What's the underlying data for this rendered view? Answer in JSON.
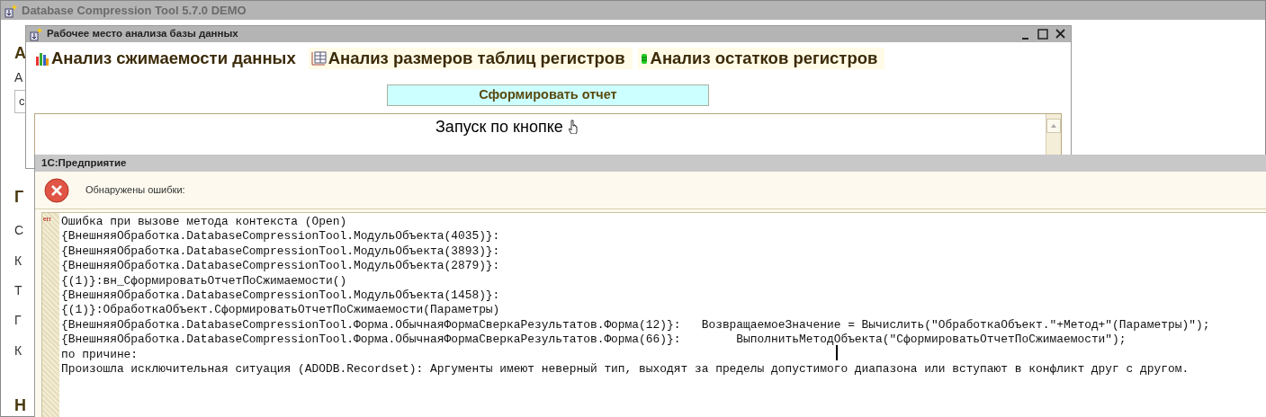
{
  "main_window": {
    "title": "Database Compression Tool 5.7.0 DEMO",
    "background_fragments": [
      {
        "text": "А",
        "kind": "heading"
      },
      {
        "text": "А",
        "kind": "label"
      },
      {
        "text": "с",
        "kind": "field"
      },
      {
        "text": "Г",
        "kind": "heading"
      },
      {
        "text": "С",
        "kind": "label"
      },
      {
        "text": "К",
        "kind": "label"
      },
      {
        "text": "Т",
        "kind": "label"
      },
      {
        "text": "Г",
        "kind": "label"
      },
      {
        "text": "К",
        "kind": "label"
      },
      {
        "text": "Н",
        "kind": "heading"
      }
    ]
  },
  "workspace_window": {
    "title": "Рабочее место анализа базы данных",
    "tabs": [
      {
        "label": "Анализ сжимаемости данных",
        "kind": "bars",
        "selected": true
      },
      {
        "label": "Анализ размеров таблиц регистров",
        "kind": "table",
        "selected": false
      },
      {
        "label": "Анализ остатков регистров",
        "kind": "stack",
        "selected": false
      }
    ],
    "generate_button": "Сформировать отчет",
    "report_text": "Запуск по кнопке"
  },
  "error_dialog": {
    "title": "1С:Предприятие",
    "header": "Обнаружены ошибки:",
    "error_marker": "err",
    "lines": [
      "Ошибка при вызове метода контекста (Open)",
      "{ВнешняяОбработка.DatabaseCompressionTool.МодульОбъекта(4035)}:",
      "{ВнешняяОбработка.DatabaseCompressionTool.МодульОбъекта(3893)}:",
      "{ВнешняяОбработка.DatabaseCompressionTool.МодульОбъекта(2879)}:",
      "{(1)}:вн_СформироватьОтчетПоСжимаемости()",
      "{ВнешняяОбработка.DatabaseCompressionTool.МодульОбъекта(1458)}:",
      "{(1)}:ОбработкаОбъект.СформироватьОтчетПоСжимаемости(Параметры)",
      "{ВнешняяОбработка.DatabaseCompressionTool.Форма.ОбычнаяФормаСверкаРезультатов.Форма(12)}:   ВозвращаемоеЗначение = Вычислить(\"ОбработкаОбъект.\"+Метод+\"(Параметры)\");",
      "{ВнешняяОбработка.DatabaseCompressionTool.Форма.ОбычнаяФормаСверкаРезультатов.Форма(66)}:        ВыполнитьМетодОбъекта(\"СформироватьОтчетПоСжимаемости\");",
      "по причине:",
      "Произошла исключительная ситуация (ADODB.Recordset): Аргументы имеют неверный тип, выходят за пределы допустимого диапазона или вступают в конфликт друг с другом."
    ]
  }
}
